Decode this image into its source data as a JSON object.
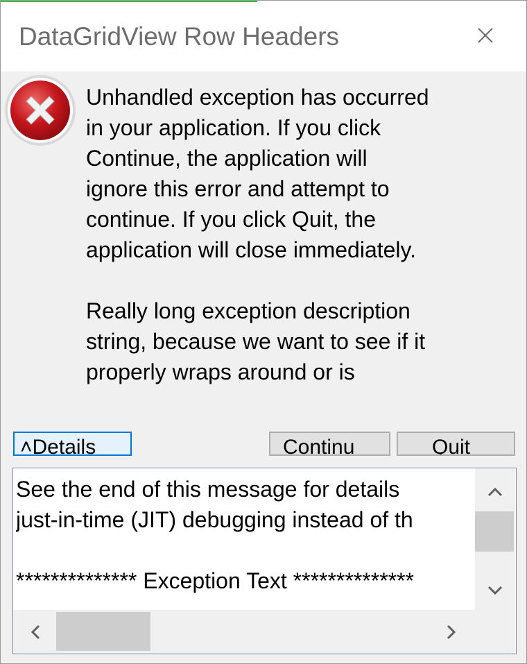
{
  "window": {
    "title": "DataGridView Row Headers",
    "accent_color": "#3cbf3c"
  },
  "icons": {
    "close": "close-icon",
    "error": "error-icon",
    "scroll_up": "chevron-up-icon",
    "scroll_down": "chevron-down-icon",
    "scroll_left": "chevron-left-icon",
    "scroll_right": "chevron-right-icon"
  },
  "message": {
    "lines": [
      "Unhandled exception has occurred",
      "in your application. If you click",
      "Continue, the application will",
      "ignore this error and attempt to",
      "continue. If you click Quit, the",
      "application will close immediately."
    ],
    "description_lines": [
      "Really long exception description",
      "string, because we want to see if it",
      "properly wraps around or is"
    ]
  },
  "buttons": {
    "details": "˄Details",
    "continue": "Continu",
    "quit": "Quit"
  },
  "details_text": {
    "lines": [
      "See the end of this message for details",
      "just-in-time (JIT) debugging instead of th",
      "",
      "************** Exception Text **************"
    ]
  },
  "colors": {
    "error_red": "#c4161c",
    "focus_blue": "#0078d7"
  }
}
